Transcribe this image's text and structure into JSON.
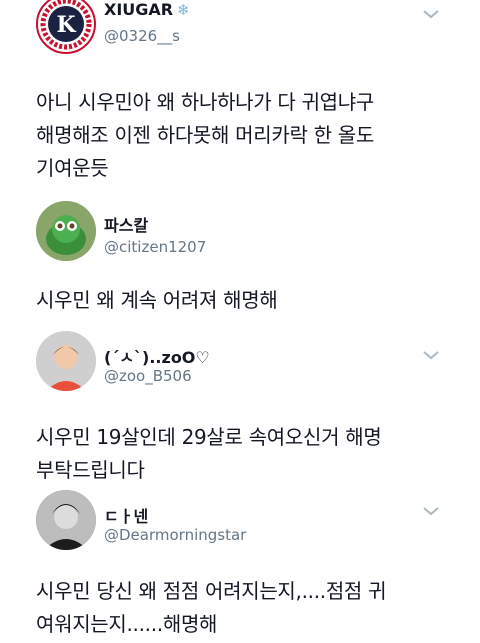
{
  "tweets": [
    {
      "display_name": "XIUGAR",
      "name_suffix_icon": "snowflake-icon",
      "handle": "@0326__s",
      "text": "아니 시우민아 왜 하나하나가 다 귀엽냐구\n해명해조 이젠 하다못해 머리카락 한 올도\n기여운듯",
      "avatar_text": "EXO MIN SEOK ARTISTS SUPPORT",
      "accent_color": "#c8102e"
    },
    {
      "display_name": "파스칼",
      "handle": "@citizen1207",
      "text": "시우민 왜 계속 어려져 해명해",
      "accent_color": "#4caf50"
    },
    {
      "display_name": "(ˊㅅˋ)..zoO♡",
      "handle": "@zoo_B506",
      "text": "시우민 19살인데 29살로 속여오신거 해명\n부탁드립니다",
      "accent_color": "#e8503a"
    },
    {
      "display_name": "ㄷㅏ넨",
      "handle": "@Dearmorningstar",
      "text": "시우민 당신 왜 점점 어려지는지,....점점 귀\n여워지는지......해명해",
      "accent_color": "#222222"
    }
  ],
  "colors": {
    "text": "#141823",
    "muted": "#657786",
    "divider": "#e6ecf0"
  }
}
